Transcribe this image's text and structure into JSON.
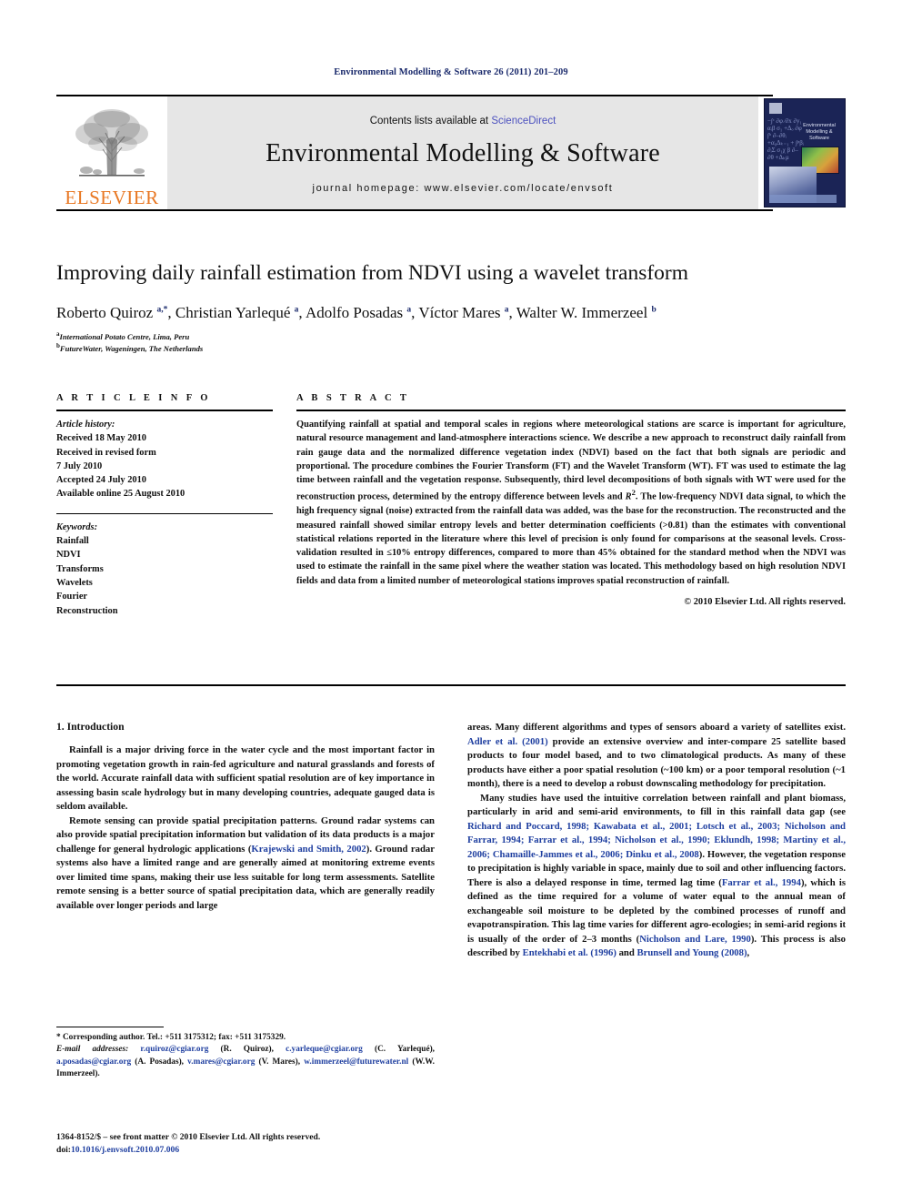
{
  "running_head": "Environmental Modelling & Software 26 (2011) 201–209",
  "masthead": {
    "contents_prefix": "Contents lists available at ",
    "sciencedirect": "ScienceDirect",
    "journal_title": "Environmental Modelling & Software",
    "homepage": "journal homepage: www.elsevier.com/locate/envsoft",
    "publisher_wordmark": "ELSEVIER",
    "cover_title": "Environmental Modelling & Software",
    "cover_equations": "−∫ᶜ ∂φ ⁄∂x ∂y₁ αᵢβ σ₁ +Δₒ ∂φ ∫ᵇ ∂–∂θᵢ +α₀Δₖ₋₁ + ∫ᵖβᵢ ∂ᵢΣ σ₁χ β ∂–∂θ +Δₖμ"
  },
  "accent_colors": {
    "link": "#1f3fa0",
    "sciencedirect": "#4c51bf",
    "elsevier_orange": "#E87722",
    "running_head": "#1a2a6c",
    "banner_bg": "#e6e6e6"
  },
  "article": {
    "title": "Improving daily rainfall estimation from NDVI using a wavelet transform",
    "authors_html": "Roberto Quiroz <sup>a,*</sup>, Christian Yarlequé <sup>a</sup>, Adolfo Posadas <sup>a</sup>, Víctor Mares <sup>a</sup>, Walter W. Immerzeel <sup>b</sup>",
    "affiliations": [
      {
        "marker": "a",
        "text": "International Potato Centre, Lima, Peru"
      },
      {
        "marker": "b",
        "text": "FutureWater, Wageningen, The Netherlands"
      }
    ]
  },
  "info": {
    "heading": "A R T I C L E  I N F O",
    "history_label": "Article history:",
    "history": [
      "Received 18 May 2010",
      "Received in revised form",
      "7 July 2010",
      "Accepted 24 July 2010",
      "Available online 25 August 2010"
    ],
    "keywords_label": "Keywords:",
    "keywords": [
      "Rainfall",
      "NDVI",
      "Transforms",
      "Wavelets",
      "Fourier",
      "Reconstruction"
    ]
  },
  "abstract": {
    "heading": "A B S T R A C T",
    "text_html": "Quantifying rainfall at spatial and temporal scales in regions where meteorological stations are scarce is important for agriculture, natural resource management and land-atmosphere interactions science. We describe a new approach to reconstruct daily rainfall from rain gauge data and the normalized difference vegetation index (NDVI) based on the fact that both signals are periodic and proportional. The procedure combines the Fourier Transform (FT) and the Wavelet Transform (WT). FT was used to estimate the lag time between rainfall and the vegetation response. Subsequently, third level decompositions of both signals with WT were used for the reconstruction process, determined by the entropy difference between levels and <i>R</i><sup>2</sup>. The low-frequency NDVI data signal, to which the high frequency signal (noise) extracted from the rainfall data was added, was the base for the reconstruction. The reconstructed and the measured rainfall showed similar entropy levels and better determination coefficients (&gt;0.81) than the estimates with conventional statistical relations reported in the literature where this level of precision is only found for comparisons at the seasonal levels. Cross-validation resulted in ≤10% entropy differences, compared to more than 45% obtained for the standard method when the NDVI was used to estimate the rainfall in the same pixel where the weather station was located. This methodology based on high resolution NDVI fields and data from a limited number of meteorological stations improves spatial reconstruction of rainfall.",
    "copyright": "© 2010 Elsevier Ltd. All rights reserved."
  },
  "body": {
    "section_heading": "1. Introduction",
    "left_paragraphs_html": [
      "Rainfall is a major driving force in the water cycle and the most important factor in promoting vegetation growth in rain-fed agriculture and natural grasslands and forests of the world. Accurate rainfall data with sufficient spatial resolution are of key importance in assessing basin scale hydrology but in many developing countries, adequate gauged data is seldom available.",
      "Remote sensing can provide spatial precipitation patterns. Ground radar systems can also provide spatial precipitation information but validation of its data products is a major challenge for general hydrologic applications (<a class=\"cite\" data-name=\"citation-link\" data-interactable=\"true\">Krajewski and Smith, 2002</a>). Ground radar systems also have a limited range and are generally aimed at monitoring extreme events over limited time spans, making their use less suitable for long term assessments. Satellite remote sensing is a better source of spatial precipitation data, which are generally readily available over longer periods and large"
    ],
    "right_paragraphs_html": [
      "areas. Many different algorithms and types of sensors aboard a variety of satellites exist. <a class=\"cite\" data-name=\"citation-link\" data-interactable=\"true\">Adler et al. (2001)</a> provide an extensive overview and inter-compare 25 satellite based products to four model based, and to two climatological products. As many of these products have either a poor spatial resolution (~100 km) or a poor temporal resolution (~1 month), there is a need to develop a robust downscaling methodology for precipitation.",
      "Many studies have used the intuitive correlation between rainfall and plant biomass, particularly in arid and semi-arid environments, to fill in this rainfall data gap (see <a class=\"cite\" data-name=\"citation-link\" data-interactable=\"true\">Richard and Poccard, 1998; Kawabata et al., 2001; Lotsch et al., 2003; Nicholson and Farrar, 1994; Farrar et al., 1994; Nicholson et al., 1990; Eklundh, 1998; Martiny et al., 2006; Chamaille-Jammes et al., 2006; Dinku et al., 2008</a>). However, the vegetation response to precipitation is highly variable in space, mainly due to soil and other influencing factors. There is also a delayed response in time, termed lag time (<a class=\"cite\" data-name=\"citation-link\" data-interactable=\"true\">Farrar et al., 1994</a>), which is defined as the time required for a volume of water equal to the annual mean of exchangeable soil moisture to be depleted by the combined processes of runoff and evapotranspiration. This lag time varies for different agro-ecologies; in semi-arid regions it is usually of the order of 2–3 months (<a class=\"cite\" data-name=\"citation-link\" data-interactable=\"true\">Nicholson and Lare, 1990</a>). This process is also described by <a class=\"cite\" data-name=\"citation-link\" data-interactable=\"true\">Entekhabi et al. (1996)</a> and <a class=\"cite\" data-name=\"citation-link\" data-interactable=\"true\">Brunsell and Young (2008)</a>,"
    ]
  },
  "footnotes": {
    "corresponding_html": "* Corresponding author. Tel.: +511 3175312; fax: +511 3175329.",
    "emails_html": "<span class=\"it\">E-mail addresses:</span> <a data-name=\"email-link\" data-interactable=\"true\">r.quiroz@cgiar.org</a> (R. Quiroz), <a data-name=\"email-link\" data-interactable=\"true\">c.yarleque@cgiar.org</a> (C. Yarlequé), <a data-name=\"email-link\" data-interactable=\"true\">a.posadas@cgiar.org</a> (A. Posadas), <a data-name=\"email-link\" data-interactable=\"true\">v.mares@cgiar.org</a> (V. Mares), <a data-name=\"email-link\" data-interactable=\"true\">w.immerzeel@futurewater.nl</a> (W.W. Immerzeel).",
    "issn_html": "1364-8152/$ – see front matter © 2010 Elsevier Ltd. All rights reserved.<br>doi:<a data-name=\"doi-link\" data-interactable=\"true\">10.1016/j.envsoft.2010.07.006</a>"
  }
}
